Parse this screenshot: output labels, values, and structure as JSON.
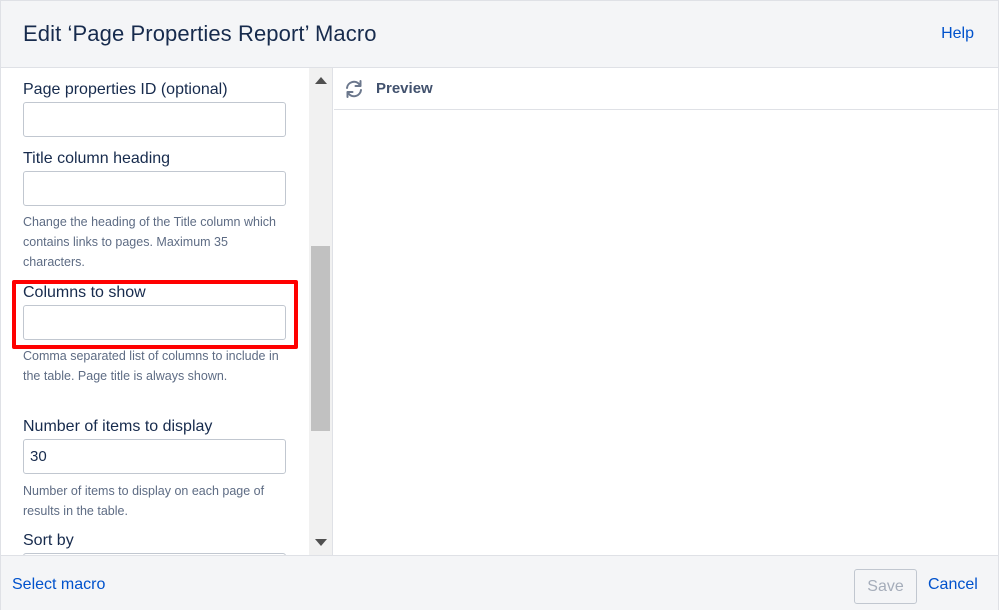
{
  "header": {
    "title": "Edit ‘Page Properties Report’ Macro",
    "help_label": "Help"
  },
  "form": {
    "fields": [
      {
        "label": "Page properties ID (optional)",
        "value": "",
        "description": ""
      },
      {
        "label": "Title column heading",
        "value": "",
        "description": "Change the heading of the Title column which contains links to pages. Maximum 35 characters."
      },
      {
        "label": "Columns to show",
        "value": "",
        "description": "Comma separated list of columns to include in the table. Page title is always shown."
      },
      {
        "label": "Number of items to display",
        "value": "30",
        "description": "Number of items to display on each page of results in the table."
      },
      {
        "label": "Sort by",
        "value": "",
        "description": ""
      }
    ]
  },
  "preview": {
    "label": "Preview",
    "icon": "refresh-icon"
  },
  "footer": {
    "select_macro_label": "Select macro",
    "save_label": "Save",
    "cancel_label": "Cancel"
  },
  "colors": {
    "link": "#0052cc",
    "highlight": "#ff0000",
    "header_bg": "#f4f5f7"
  }
}
